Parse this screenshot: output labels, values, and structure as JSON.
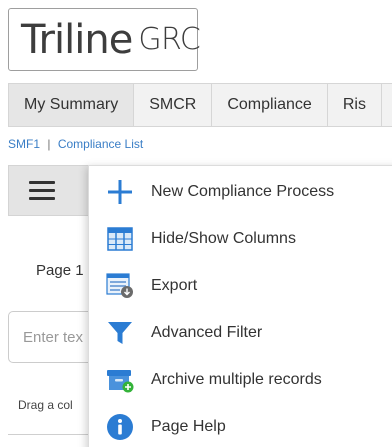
{
  "logo": {
    "main": "Triline",
    "sub": "GRC"
  },
  "nav": {
    "tabs": [
      {
        "label": "My Summary"
      },
      {
        "label": "SMCR"
      },
      {
        "label": "Compliance"
      },
      {
        "label": "Ris"
      }
    ]
  },
  "breadcrumb": {
    "first": "SMF1",
    "separator": "|",
    "second": "Compliance List"
  },
  "page": {
    "label": "Page 1"
  },
  "filter": {
    "placeholder": "Enter tex"
  },
  "drag": {
    "label": "Drag a col"
  },
  "menu": {
    "items": [
      {
        "label": "New Compliance Process",
        "icon": "plus-icon"
      },
      {
        "label": "Hide/Show Columns",
        "icon": "columns-icon"
      },
      {
        "label": "Export",
        "icon": "export-icon"
      },
      {
        "label": "Advanced Filter",
        "icon": "funnel-icon"
      },
      {
        "label": "Archive multiple records",
        "icon": "archive-icon"
      },
      {
        "label": "Page Help",
        "icon": "info-icon"
      }
    ]
  },
  "colors": {
    "accent": "#2b7cd3",
    "link": "#3a7ec6",
    "green": "#34b33a"
  }
}
